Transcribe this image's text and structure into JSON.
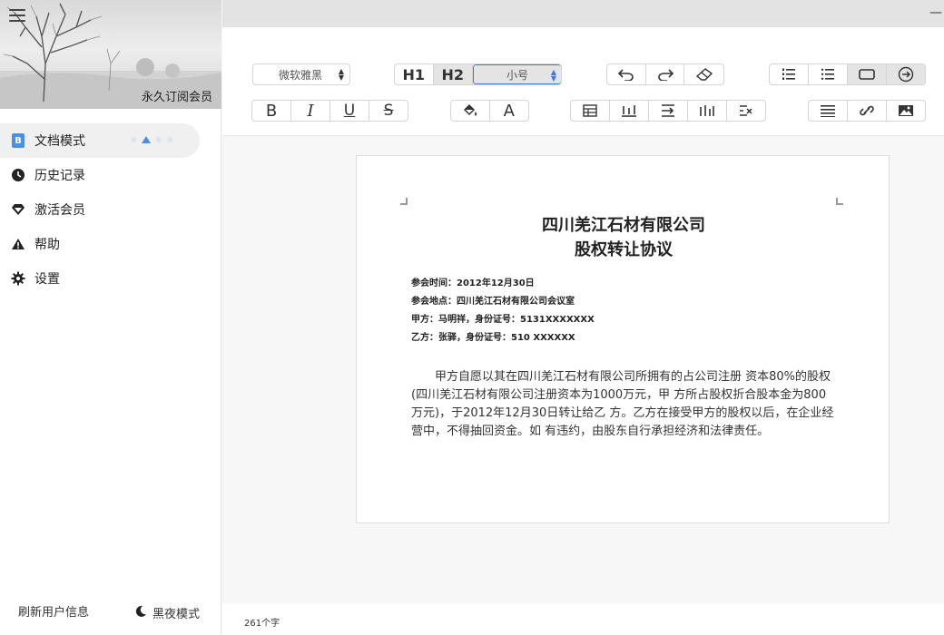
{
  "sidebar": {
    "member_label": "永久订阅会员",
    "items": [
      {
        "label": "文档模式",
        "icon": "document-b-icon",
        "active": true
      },
      {
        "label": "历史记录",
        "icon": "clock-icon"
      },
      {
        "label": "激活会员",
        "icon": "diamond-icon"
      },
      {
        "label": "帮助",
        "icon": "warning-icon"
      },
      {
        "label": "设置",
        "icon": "gear-icon"
      }
    ],
    "refresh_label": "刷新用户信息",
    "night_label": "黑夜模式"
  },
  "toolbar": {
    "font_family": "微软雅黑",
    "font_size": "小号",
    "heading1": "H1",
    "heading2": "H2",
    "bold": "B",
    "italic": "I",
    "underline": "U",
    "strike": "S",
    "font_color": "A",
    "accent_color": "#3a7bd5"
  },
  "document": {
    "title_line1": "四川羌江石材有限公司",
    "title_line2": "股权转让协议",
    "meta": [
      "参会时间：2012年12月30日",
      "参会地点：四川羌江石材有限公司会议室",
      "甲方：马明祥，身份证号：5131XXXXXXX",
      "乙方：张驿，身份证号：510 XXXXXX"
    ],
    "body": "甲方自愿以其在四川羌江石材有限公司所拥有的占公司注册 资本80%的股权(四川羌江石材有限公司注册资本为1000万元，甲 方所占股权折合股本金为800万元)，于2012年12月30日转让给乙 方。乙方在接受甲方的股权以后，在企业经营中，不得抽回资金。如 有违约，由股东自行承担经济和法律责任。"
  },
  "status": {
    "word_count": "261个字"
  }
}
